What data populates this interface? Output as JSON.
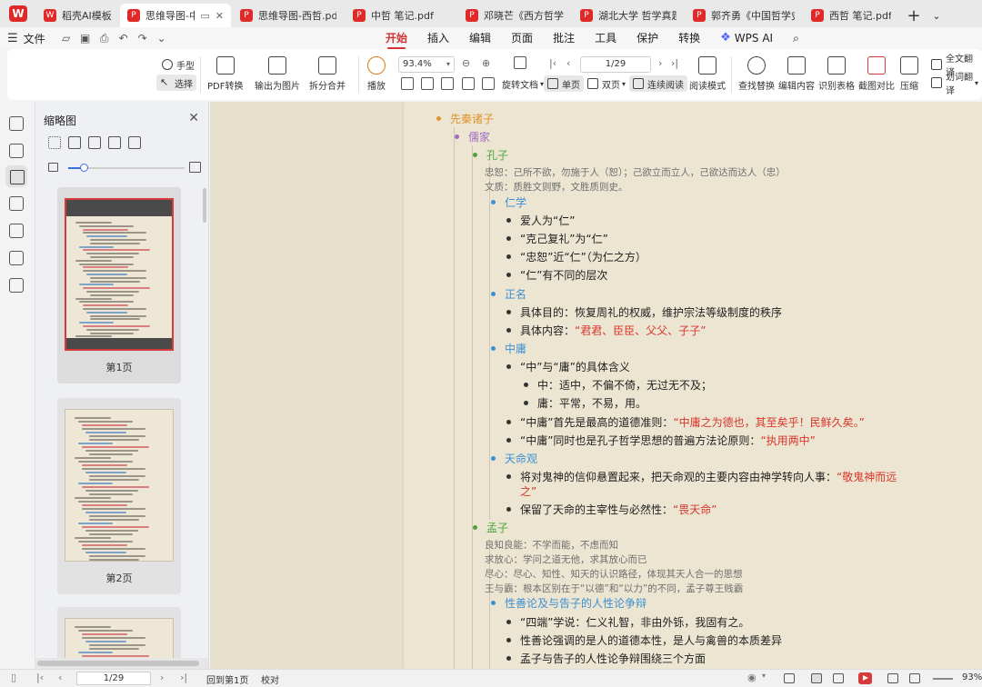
{
  "tabs": [
    {
      "label": "稻壳AI模板",
      "icon": "wps-template-icon"
    },
    {
      "label": "思维导图-中哲",
      "icon": "pdf-icon",
      "active": true
    },
    {
      "label": "思维导图-西哲.pdf",
      "icon": "pdf-icon"
    },
    {
      "label": "中哲 笔记.pdf",
      "icon": "pdf-icon"
    },
    {
      "label": "邓晓芒《西方哲学史》",
      "icon": "pdf-icon"
    },
    {
      "label": "湖北大学 哲学真题200",
      "icon": "pdf-icon"
    },
    {
      "label": "郭齐勇《中国哲学史》",
      "icon": "pdf-icon"
    },
    {
      "label": "西哲 笔记.pdf",
      "icon": "pdf-icon"
    }
  ],
  "menu": {
    "file": "文件",
    "tabs": [
      "开始",
      "插入",
      "编辑",
      "页面",
      "批注",
      "工具",
      "保护",
      "转换"
    ],
    "active_tab": "开始",
    "wps_ai": "WPS AI"
  },
  "toolbar": {
    "hand": "手型",
    "select": "选择",
    "pdf_convert": "PDF转换",
    "export_image": "输出为图片",
    "split_merge": "拆分合并",
    "play": "播放",
    "zoom": "93.4%",
    "page": "1/29",
    "rotate": "旋转文档",
    "single": "单页",
    "double": "双页",
    "continuous": "连续阅读",
    "read_mode": "阅读模式",
    "find_replace": "查找替换",
    "edit_content": "编辑内容",
    "recognize_table": "识别表格",
    "screenshot_compare": "截图对比",
    "compress": "压缩",
    "full_translate": "全文翻译",
    "word_translate": "划词翻译"
  },
  "thumbnails": {
    "title": "缩略图",
    "slider_fraction": 0.13,
    "pages": [
      "第1页",
      "第2页"
    ]
  },
  "doc": {
    "l0": "先秦诸子",
    "l1": "儒家",
    "l2_kongzi": "孔子",
    "note_k1": "忠恕：己所不欲，勿施于人（恕）；己欲立而立人，己欲达而达人（忠）",
    "note_k2": "文质：质胜文则野，文胜质则史。",
    "ren": "仁学",
    "ren1": "爱人为“仁”",
    "ren2": "“克己复礼”为“仁”",
    "ren3": "“忠恕”近“仁”（为仁之方）",
    "ren4": "“仁”有不同的层次",
    "zm": "正名",
    "zm1": "具体目的：恢复周礼的权威，维护宗法等级制度的秩序",
    "zm2a": "具体内容：",
    "zm2b": "“君君、臣臣、父父、子子”",
    "zy": "中庸",
    "zy1": "“中”与“庸”的具体含义",
    "zy1a": "中：适中，不偏不倚，无过无不及；",
    "zy1b": "庸：平常，不易，用。",
    "zy2a": "“中庸”首先是最高的道德准则：",
    "zy2b": "“中庸之为德也，其至矣乎！民鲜久矣。”",
    "zy3a": "“中庸”同时也是孔子哲学思想的普遍方法论原则：",
    "zy3b": "“执用两中”",
    "tm": "天命观",
    "tm1a": "将对鬼神的信仰悬置起来，把天命观的主要内容由神学转向人事：",
    "tm1b": "“敬鬼神而远",
    "tm1c": "之”",
    "tm2a": "保留了天命的主宰性与必然性：",
    "tm2b": "“畏天命”",
    "l2_mengzi": "孟子",
    "note_m1": "良知良能：不学而能，不虑而知",
    "note_m2": "求放心：学问之道无他，求其放心而已",
    "note_m3": "尽心：尽心、知性、知天的认识路径，体现其天人合一的思想",
    "note_m4": "王与霸：根本区别在于“以德”和“以力”的不同，孟子尊王贱霸",
    "xs": "性善论及与告子的人性论争辩",
    "xs1": "“四端”学说：仁义礼智，非由外铄，我固有之。",
    "xs2": "性善论强调的是人的道德本性，是人与禽兽的本质差异",
    "xs3": "孟子与告子的人性论争辩围绕三个方面"
  },
  "status": {
    "page": "1/29",
    "back": "回到第1页",
    "proof": "校对",
    "zoom": "93%"
  },
  "colors": {
    "accent": "#d23434",
    "orange": "#e0932a",
    "purple": "#a06ac3",
    "green": "#4fa63f",
    "blue": "#3d8fd1",
    "red": "#d8362b"
  }
}
